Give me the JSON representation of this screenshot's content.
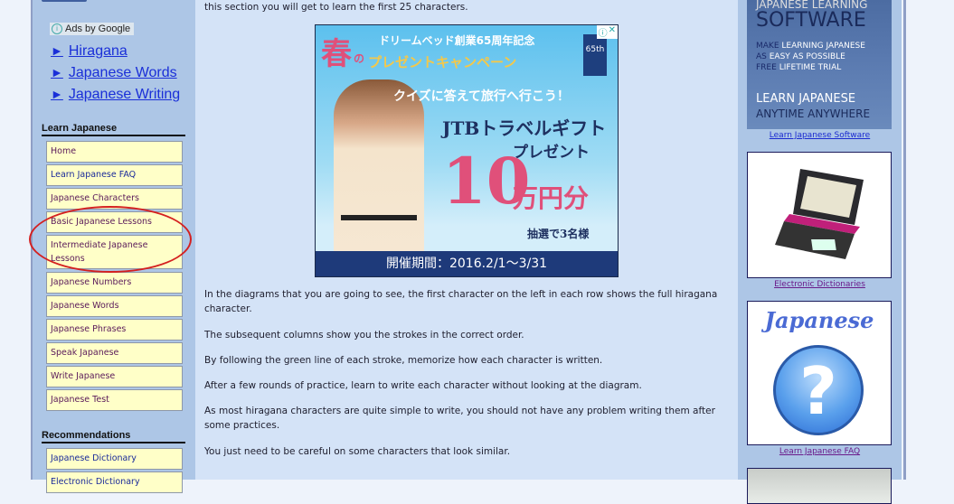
{
  "left_sidebar": {
    "ads_label": "Ads by Google",
    "ad_links": [
      "Hiragana",
      "Japanese Words",
      "Japanese Writing"
    ],
    "ad_link_marker": "►",
    "learn_section": {
      "heading": "Learn Japanese",
      "items": [
        {
          "label": "Home"
        },
        {
          "label": "Learn Japanese FAQ"
        },
        {
          "label": "Japanese Characters"
        },
        {
          "label": "Basic Japanese Lessons"
        },
        {
          "label": "Intermediate Japanese Lessons"
        },
        {
          "label": "Japanese Numbers"
        },
        {
          "label": "Japanese Words"
        },
        {
          "label": "Japanese Phrases"
        },
        {
          "label": "Speak Japanese"
        },
        {
          "label": "Write Japanese"
        },
        {
          "label": "Japanese Test"
        }
      ]
    },
    "recommend_section": {
      "heading": "Recommendations",
      "items": [
        {
          "label": "Japanese Dictionary"
        },
        {
          "label": "Electronic Dictionary"
        }
      ]
    },
    "annotation_color": "#d42020"
  },
  "main": {
    "intro_tail": "this section you will get to learn the first 25 characters.",
    "ad": {
      "spring": "春",
      "no": "の",
      "line1": "ドリームベッド創業65周年記念",
      "line2": "プレゼントキャンペーン",
      "badge": "65th",
      "quiz": "クイズに答えて旅行へ行こう！",
      "jtb": "JTBトラベルギフト",
      "present": "プレゼント",
      "amount": "10",
      "amount_unit": "万円分",
      "lottery": "抽選で3名様",
      "period": "開催期間：2016.2/1〜3/31",
      "info_icon": "ⓘ",
      "close_icon": "✕"
    },
    "paragraphs": [
      "In the diagrams that you are going to see, the first character on the left in each row shows the full hiragana character.",
      "The subsequent columns show you the strokes in the correct order.",
      "By following the green line of each stroke, memorize how each character is written.",
      "After a few rounds of practice, learn to write each character without looking at the diagram.",
      "As most hiragana characters are quite simple to write, you should not have any problem writing them after some practices.",
      "You just need to be careful on some characters that look similar."
    ]
  },
  "right_sidebar": {
    "software": {
      "line1": "JAPANESE LEARNING",
      "line2": "SOFTWARE",
      "make": "MAKE",
      "make_rest": "LEARNING JAPANESE",
      "as": "AS",
      "as_rest": "EASY AS POSSIBLE",
      "free": "FREE",
      "free_rest": "LIFETIME TRIAL",
      "learn": "LEARN JAPANESE",
      "anytime": "ANYTIME ANYWHERE",
      "caption": "Learn Japanese Software"
    },
    "dictionary": {
      "caption": "Electronic Dictionaries"
    },
    "faq": {
      "title": "Japanese",
      "glyph": "?",
      "caption": "Learn Japanese FAQ"
    }
  }
}
